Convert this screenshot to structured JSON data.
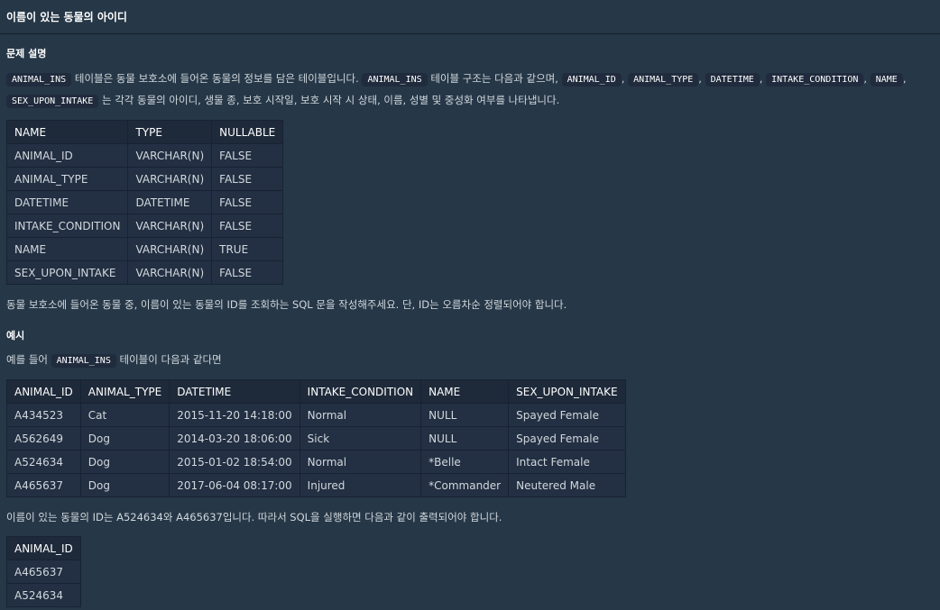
{
  "page_title": "이름이 있는 동물의 아이디",
  "description": {
    "heading": "문제 설명",
    "code_table": "ANIMAL_INS",
    "text1": "테이블은 동물 보호소에 들어온 동물의 정보를 담은 테이블입니다.",
    "text2": "테이블 구조는 다음과 같으며,",
    "col_codes": [
      "ANIMAL_ID",
      "ANIMAL_TYPE",
      "DATETIME",
      "INTAKE_CONDITION",
      "NAME",
      "SEX_UPON_INTAKE"
    ],
    "comma": ",",
    "text3": "는 각각 동물의 아이디, 생물 종, 보호 시작일, 보호 시작 시 상태, 이름, 성별 및 중성화 여부를 나타냅니다."
  },
  "schema_table": {
    "headers": [
      "NAME",
      "TYPE",
      "NULLABLE"
    ],
    "rows": [
      [
        "ANIMAL_ID",
        "VARCHAR(N)",
        "FALSE"
      ],
      [
        "ANIMAL_TYPE",
        "VARCHAR(N)",
        "FALSE"
      ],
      [
        "DATETIME",
        "DATETIME",
        "FALSE"
      ],
      [
        "INTAKE_CONDITION",
        "VARCHAR(N)",
        "FALSE"
      ],
      [
        "NAME",
        "VARCHAR(N)",
        "TRUE"
      ],
      [
        "SEX_UPON_INTAKE",
        "VARCHAR(N)",
        "FALSE"
      ]
    ]
  },
  "task_text": "동물 보호소에 들어온 동물 중, 이름이 있는 동물의 ID를 조회하는 SQL 문을 작성해주세요. 단, ID는 오름차순 정렬되어야 합니다.",
  "example": {
    "heading": "예시",
    "intro_before": "예를 들어",
    "intro_code": "ANIMAL_INS",
    "intro_after": "테이블이 다음과 같다면"
  },
  "example_table": {
    "headers": [
      "ANIMAL_ID",
      "ANIMAL_TYPE",
      "DATETIME",
      "INTAKE_CONDITION",
      "NAME",
      "SEX_UPON_INTAKE"
    ],
    "rows": [
      [
        "A434523",
        "Cat",
        "2015-11-20 14:18:00",
        "Normal",
        "NULL",
        "Spayed Female"
      ],
      [
        "A562649",
        "Dog",
        "2014-03-20 18:06:00",
        "Sick",
        "NULL",
        "Spayed Female"
      ],
      [
        "A524634",
        "Dog",
        "2015-01-02 18:54:00",
        "Normal",
        "*Belle",
        "Intact Female"
      ],
      [
        "A465637",
        "Dog",
        "2017-06-04 08:17:00",
        "Injured",
        "*Commander",
        "Neutered Male"
      ]
    ]
  },
  "result_text": "이름이 있는 동물의 ID는 A524634와 A465637입니다. 따라서 SQL을 실행하면 다음과 같이 출력되어야 합니다.",
  "result_table": {
    "headers": [
      "ANIMAL_ID"
    ],
    "rows": [
      [
        "A465637"
      ],
      [
        "A524634"
      ]
    ]
  }
}
